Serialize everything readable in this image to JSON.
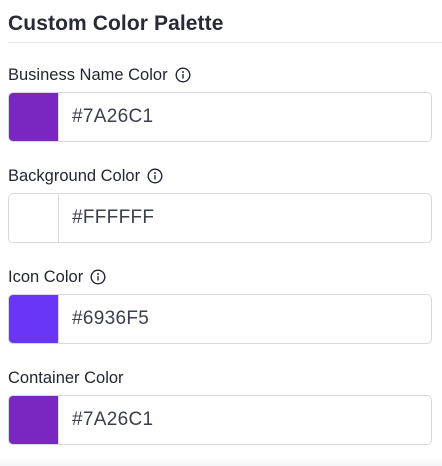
{
  "palette": {
    "title": "Custom Color Palette",
    "fields": [
      {
        "label": "Business Name Color",
        "has_info": true,
        "value": "#7A26C1",
        "swatch_color": "#7A26C1"
      },
      {
        "label": "Background Color",
        "has_info": true,
        "value": "#FFFFFF",
        "swatch_color": "#FFFFFF"
      },
      {
        "label": "Icon Color",
        "has_info": true,
        "value": "#6936F5",
        "swatch_color": "#6936F5"
      },
      {
        "label": "Container Color",
        "has_info": false,
        "value": "#7A26C1",
        "swatch_color": "#7A26C1"
      }
    ]
  },
  "icons": {
    "info": "info-circle-icon"
  },
  "colors": {
    "border": "#D6D9DE",
    "divider": "#E6E8EC",
    "text": "#222631"
  }
}
